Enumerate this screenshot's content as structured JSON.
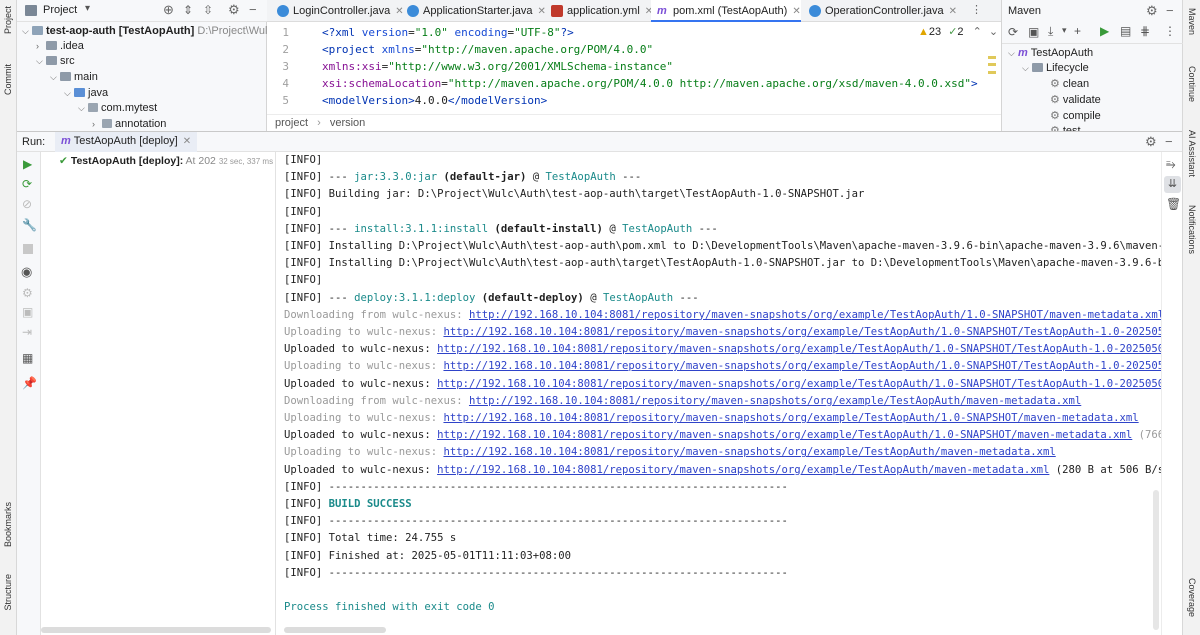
{
  "left_stripe": {
    "project": "Project",
    "commit": "Commit",
    "bookmarks": "Bookmarks",
    "structure": "Structure"
  },
  "right_stripe": {
    "maven": "Maven",
    "continue": "Continue",
    "ai_assistant": "AI Assistant",
    "notifications": "Notifications",
    "coverage": "Coverage"
  },
  "project_panel": {
    "title": "Project",
    "tree": [
      {
        "label": "test-aop-auth [TestAopAuth]",
        "hint": "D:\\Project\\Wulc\\",
        "kind": "module"
      },
      {
        "label": ".idea",
        "kind": "folder"
      },
      {
        "label": "src",
        "kind": "folder"
      },
      {
        "label": "main",
        "kind": "folder"
      },
      {
        "label": "java",
        "kind": "folder"
      },
      {
        "label": "com.mytest",
        "kind": "package"
      },
      {
        "label": "annotation",
        "kind": "package"
      }
    ]
  },
  "tabs": [
    {
      "label": "LoginController.java",
      "icon": "java-class-icon",
      "color": "#3b8bd9"
    },
    {
      "label": "ApplicationStarter.java",
      "icon": "java-class-icon",
      "color": "#3b8bd9"
    },
    {
      "label": "application.yml",
      "icon": "yaml-icon",
      "color": "#c0392b"
    },
    {
      "label": "pom.xml (TestAopAuth)",
      "icon": "maven-icon",
      "color": "#7b4fd6",
      "active": true
    },
    {
      "label": "OperationController.java",
      "icon": "java-class-icon",
      "color": "#3b8bd9"
    }
  ],
  "editor": {
    "warnings": "23",
    "checks": "2",
    "line_numbers": [
      "1",
      "2",
      "3",
      "4",
      "5"
    ],
    "lines": [
      [
        {
          "t": "<?",
          "c": "kw"
        },
        {
          "t": "xml ",
          "c": "kw"
        },
        {
          "t": "version",
          "c": "attr"
        },
        {
          "t": "=",
          "c": ""
        },
        {
          "t": "\"1.0\"",
          "c": "str"
        },
        {
          "t": " encoding",
          "c": "attr"
        },
        {
          "t": "=",
          "c": ""
        },
        {
          "t": "\"UTF-8\"",
          "c": "str"
        },
        {
          "t": "?>",
          "c": "kw"
        }
      ],
      [
        {
          "t": "<",
          "c": "kw"
        },
        {
          "t": "project ",
          "c": "kw"
        },
        {
          "t": "xmlns",
          "c": "attr"
        },
        {
          "t": "=",
          "c": ""
        },
        {
          "t": "\"http://maven.apache.org/POM/4.0.0\"",
          "c": "str"
        }
      ],
      [
        {
          "t": "         xmlns:xsi",
          "c": "atn"
        },
        {
          "t": "=",
          "c": ""
        },
        {
          "t": "\"http://www.w3.org/2001/XMLSchema-instance\"",
          "c": "str"
        }
      ],
      [
        {
          "t": "         xsi:schemaLocation",
          "c": "atn"
        },
        {
          "t": "=",
          "c": ""
        },
        {
          "t": "\"http://maven.apache.org/POM/4.0.0 http://maven.apache.org/xsd/maven-4.0.0.xsd\"",
          "c": "str"
        },
        {
          "t": ">",
          "c": "kw"
        }
      ],
      [
        {
          "t": "    <",
          "c": "kw"
        },
        {
          "t": "modelVersion",
          "c": "kw"
        },
        {
          "t": ">",
          "c": "kw"
        },
        {
          "t": "4.0.0",
          "c": ""
        },
        {
          "t": "</",
          "c": "kw"
        },
        {
          "t": "modelVersion",
          "c": "kw"
        },
        {
          "t": ">",
          "c": "kw"
        }
      ]
    ],
    "breadcrumb": [
      "project",
      "version"
    ]
  },
  "maven_panel": {
    "title": "Maven",
    "tree": [
      {
        "label": "TestAopAuth",
        "level": 0
      },
      {
        "label": "Lifecycle",
        "level": 1
      },
      {
        "label": "clean",
        "level": 2
      },
      {
        "label": "validate",
        "level": 2
      },
      {
        "label": "compile",
        "level": 2
      },
      {
        "label": "test",
        "level": 2
      }
    ]
  },
  "run_panel": {
    "run_label": "Run:",
    "tab_label": "TestAopAuth [deploy]",
    "tree_item": {
      "label": "TestAopAuth [deploy]:",
      "time_prefix": "At 202",
      "duration": "32 sec, 337 ms"
    },
    "console": [
      [
        {
          "t": "[INFO]"
        }
      ],
      [
        {
          "t": "[INFO] --- "
        },
        {
          "t": "jar:3.3.0:jar",
          "s": "teal"
        },
        {
          "t": " "
        },
        {
          "t": "(default-jar)",
          "s": "b"
        },
        {
          "t": " @ "
        },
        {
          "t": "TestAopAuth",
          "s": "teal"
        },
        {
          "t": " ---"
        }
      ],
      [
        {
          "t": "[INFO] Building jar: D:\\Project\\Wulc\\Auth\\test-aop-auth\\target\\TestAopAuth-1.0-SNAPSHOT.jar"
        }
      ],
      [
        {
          "t": "[INFO]"
        }
      ],
      [
        {
          "t": "[INFO] --- "
        },
        {
          "t": "install:3.1.1:install",
          "s": "teal"
        },
        {
          "t": " "
        },
        {
          "t": "(default-install)",
          "s": "b"
        },
        {
          "t": " @ "
        },
        {
          "t": "TestAopAuth",
          "s": "teal"
        },
        {
          "t": " ---"
        }
      ],
      [
        {
          "t": "[INFO] Installing D:\\Project\\Wulc\\Auth\\test-aop-auth\\pom.xml to D:\\DevelopmentTools\\Maven\\apache-maven-3.9.6-bin\\apache-maven-3.9.6\\maven-rep"
        }
      ],
      [
        {
          "t": "[INFO] Installing D:\\Project\\Wulc\\Auth\\test-aop-auth\\target\\TestAopAuth-1.0-SNAPSHOT.jar to D:\\DevelopmentTools\\Maven\\apache-maven-3.9.6-bin"
        }
      ],
      [
        {
          "t": "[INFO]"
        }
      ],
      [
        {
          "t": "[INFO] --- "
        },
        {
          "t": "deploy:3.1.1:deploy",
          "s": "teal"
        },
        {
          "t": " "
        },
        {
          "t": "(default-deploy)",
          "s": "b"
        },
        {
          "t": " @ "
        },
        {
          "t": "TestAopAuth",
          "s": "teal"
        },
        {
          "t": " ---"
        }
      ],
      [
        {
          "t": "Downloading from wulc-nexus: ",
          "s": "g"
        },
        {
          "t": "http://192.168.10.104:8081/repository/maven-snapshots/org/example/TestAopAuth/1.0-SNAPSHOT/maven-metadata.xml",
          "s": "a"
        }
      ],
      [
        {
          "t": "Uploading to wulc-nexus: ",
          "s": "g"
        },
        {
          "t": "http://192.168.10.104:8081/repository/maven-snapshots/org/example/TestAopAuth/1.0-SNAPSHOT/TestAopAuth-1.0-20250501",
          "s": "a"
        }
      ],
      [
        {
          "t": "Uploaded to wulc-nexus: "
        },
        {
          "t": "http://192.168.10.104:8081/repository/maven-snapshots/org/example/TestAopAuth/1.0-SNAPSHOT/TestAopAuth-1.0-20250501.",
          "s": "a"
        }
      ],
      [
        {
          "t": "Uploading to wulc-nexus: ",
          "s": "g"
        },
        {
          "t": "http://192.168.10.104:8081/repository/maven-snapshots/org/example/TestAopAuth/1.0-SNAPSHOT/TestAopAuth-1.0-20250501",
          "s": "a"
        }
      ],
      [
        {
          "t": "Uploaded to wulc-nexus: "
        },
        {
          "t": "http://192.168.10.104:8081/repository/maven-snapshots/org/example/TestAopAuth/1.0-SNAPSHOT/TestAopAuth-1.0-20250501.",
          "s": "a"
        }
      ],
      [
        {
          "t": "Downloading from wulc-nexus: ",
          "s": "g"
        },
        {
          "t": "http://192.168.10.104:8081/repository/maven-snapshots/org/example/TestAopAuth/maven-metadata.xml",
          "s": "a"
        }
      ],
      [
        {
          "t": "Uploading to wulc-nexus: ",
          "s": "g"
        },
        {
          "t": "http://192.168.10.104:8081/repository/maven-snapshots/org/example/TestAopAuth/1.0-SNAPSHOT/maven-metadata.xml",
          "s": "a"
        }
      ],
      [
        {
          "t": "Uploaded to wulc-nexus: "
        },
        {
          "t": "http://192.168.10.104:8081/repository/maven-snapshots/org/example/TestAopAuth/1.0-SNAPSHOT/maven-metadata.xml",
          "s": "a"
        },
        {
          "t": " (766 B",
          "s": "g"
        }
      ],
      [
        {
          "t": "Uploading to wulc-nexus: ",
          "s": "g"
        },
        {
          "t": "http://192.168.10.104:8081/repository/maven-snapshots/org/example/TestAopAuth/maven-metadata.xml",
          "s": "a"
        }
      ],
      [
        {
          "t": "Uploaded to wulc-nexus: "
        },
        {
          "t": "http://192.168.10.104:8081/repository/maven-snapshots/org/example/TestAopAuth/maven-metadata.xml",
          "s": "a"
        },
        {
          "t": " (280 B at 506 B/s)"
        }
      ],
      [
        {
          "t": "[INFO] ------------------------------------------------------------------------"
        }
      ],
      [
        {
          "t": "[INFO] "
        },
        {
          "t": "BUILD SUCCESS",
          "s": "gs"
        }
      ],
      [
        {
          "t": "[INFO] ------------------------------------------------------------------------"
        }
      ],
      [
        {
          "t": "[INFO] Total time:  24.755 s"
        }
      ],
      [
        {
          "t": "[INFO] Finished at: 2025-05-01T11:11:03+08:00"
        }
      ],
      [
        {
          "t": "[INFO] ------------------------------------------------------------------------"
        }
      ],
      [
        {
          "t": ""
        }
      ],
      [
        {
          "t": "Process finished with exit code 0",
          "s": "teal"
        }
      ]
    ]
  }
}
